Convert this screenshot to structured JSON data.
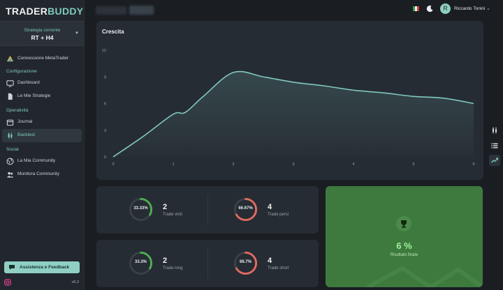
{
  "app": {
    "logo_left": "TRADER",
    "logo_right": "BUDDY",
    "version": "v6.3"
  },
  "sidebar": {
    "strategy_label": "Strategia corrente",
    "strategy_value": "RT + H4",
    "connection_label": "Connessione MetaTrader",
    "sections": {
      "config": "Configurazione",
      "operativity": "Operatività",
      "social": "Social"
    },
    "items": {
      "dashboard": "Dashboard",
      "strategies": "Le Mie Strategie",
      "journal": "Journal",
      "backtest": "Backtest",
      "community": "La Mia Community",
      "monitor": "Monitora Community"
    },
    "active_item": "backtest",
    "help_button": "Assistenza e Feedback"
  },
  "header": {
    "user_initial": "R",
    "user_name": "Riccardo Tonini",
    "language_flag": "italy"
  },
  "chart": {
    "title": "Crescita"
  },
  "chart_data": {
    "type": "area",
    "title": "Crescita",
    "x": [
      0,
      0.5,
      1,
      1.2,
      1.5,
      2,
      2.5,
      3,
      3.5,
      4,
      4.5,
      5,
      5.5,
      6
    ],
    "values": [
      0,
      2.3,
      4.8,
      5.0,
      6.8,
      9.5,
      9.0,
      8.4,
      8.0,
      7.5,
      7.2,
      6.8,
      6.6,
      6.0
    ],
    "x_ticks": [
      "0",
      "1",
      "2",
      "3",
      "4",
      "5",
      "6"
    ],
    "y_ticks": [
      "0",
      "3",
      "6",
      "9",
      "12"
    ],
    "xlim": [
      0,
      6
    ],
    "ylim": [
      0,
      12
    ],
    "grid": false,
    "line_color": "#7fc9bd"
  },
  "stats": [
    {
      "percent_label": "33.33%",
      "fraction": 0.3333,
      "value": "2",
      "caption": "Trade vinti",
      "color": "#4caf50"
    },
    {
      "percent_label": "66.67%",
      "fraction": 0.6667,
      "value": "4",
      "caption": "Trade persi",
      "color": "#e06a62"
    },
    {
      "percent_label": "33.3%",
      "fraction": 0.333,
      "value": "2",
      "caption": "Trade long",
      "color": "#4caf50"
    },
    {
      "percent_label": "66.7%",
      "fraction": 0.667,
      "value": "4",
      "caption": "Trade short",
      "color": "#e06a62"
    }
  ],
  "result": {
    "value": "6 %",
    "caption": "Risultato finale"
  },
  "icons": {
    "rail": [
      "candlestick-icon",
      "list-icon",
      "trend-icon"
    ]
  }
}
